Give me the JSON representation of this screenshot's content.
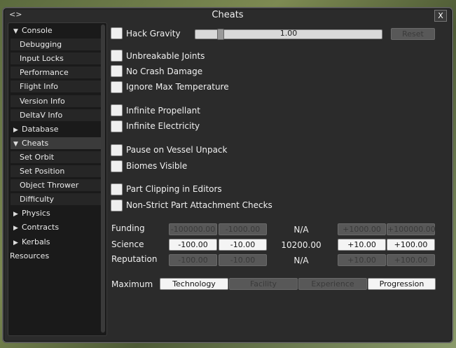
{
  "window": {
    "title": "Cheats",
    "close_label": "X",
    "drag_icon": "<>"
  },
  "sidebar": {
    "items": [
      {
        "label": "Console",
        "arrow": "▼",
        "type": "group"
      },
      {
        "label": "Debugging",
        "type": "sub"
      },
      {
        "label": "Input Locks",
        "type": "sub"
      },
      {
        "label": "Performance",
        "type": "sub"
      },
      {
        "label": "Flight Info",
        "type": "sub"
      },
      {
        "label": "Version Info",
        "type": "sub"
      },
      {
        "label": "DeltaV Info",
        "type": "sub"
      },
      {
        "label": "Database",
        "arrow": "▶",
        "type": "group"
      },
      {
        "label": "Cheats",
        "arrow": "▼",
        "type": "group"
      },
      {
        "label": "Set Orbit",
        "type": "sub"
      },
      {
        "label": "Set Position",
        "type": "sub"
      },
      {
        "label": "Object Thrower",
        "type": "sub"
      },
      {
        "label": "Difficulty",
        "type": "sub"
      },
      {
        "label": "Physics",
        "arrow": "▶",
        "type": "group"
      },
      {
        "label": "Contracts",
        "arrow": "▶",
        "type": "group"
      },
      {
        "label": "Kerbals",
        "arrow": "▶",
        "type": "group"
      },
      {
        "label": "Resources",
        "type": "plain"
      }
    ]
  },
  "cheats": {
    "hack_gravity": {
      "label": "Hack Gravity",
      "value": "1.00",
      "slider_fraction": 0.12,
      "reset": "Reset"
    },
    "unbreakable_joints": "Unbreakable Joints",
    "no_crash_damage": "No Crash Damage",
    "ignore_max_temp": "Ignore Max Temperature",
    "infinite_propellant": "Infinite Propellant",
    "infinite_electricity": "Infinite Electricity",
    "pause_unpack": "Pause on Vessel Unpack",
    "biomes_visible": "Biomes Visible",
    "part_clipping": "Part Clipping in Editors",
    "non_strict": "Non-Strict Part Attachment Checks"
  },
  "currency": {
    "funding": {
      "label": "Funding",
      "m1": "-100000.00",
      "m2": "-1000.00",
      "value": "N/A",
      "p1": "+1000.00",
      "p2": "+100000.00"
    },
    "science": {
      "label": "Science",
      "m1": "-100.00",
      "m2": "-10.00",
      "value": "10200.00",
      "p1": "+10.00",
      "p2": "+100.00"
    },
    "reputation": {
      "label": "Reputation",
      "m1": "-100.00",
      "m2": "-10.00",
      "value": "N/A",
      "p1": "+10.00",
      "p2": "+100.00"
    }
  },
  "maximum": {
    "label": "Maximum",
    "technology": "Technology",
    "facility": "Facility",
    "experience": "Experience",
    "progression": "Progression"
  }
}
